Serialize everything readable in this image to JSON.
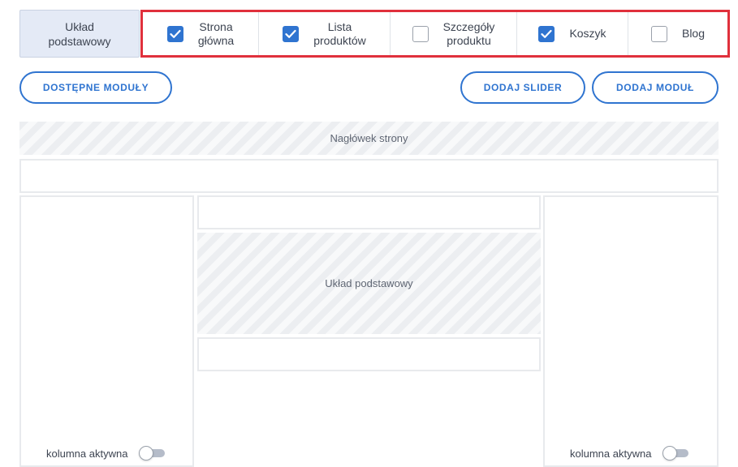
{
  "tabs": {
    "base": {
      "line1": "Układ",
      "line2": "podstawowy"
    },
    "items": [
      {
        "line1": "Strona",
        "line2": "główna",
        "checked": true
      },
      {
        "line1": "Lista",
        "line2": "produktów",
        "checked": true
      },
      {
        "line1": "Szczegóły",
        "line2": "produktu",
        "checked": false
      },
      {
        "line1": "Koszyk",
        "line2": "",
        "checked": true
      },
      {
        "line1": "Blog",
        "line2": "",
        "checked": false
      }
    ]
  },
  "toolbar": {
    "available_modules": "DOSTĘPNE MODUŁY",
    "add_slider": "DODAJ SLIDER",
    "add_module": "DODAJ MODUŁ"
  },
  "layout": {
    "header_label": "Nagłówek strony",
    "center_label": "Układ podstawowy",
    "left_column": {
      "label": "kolumna aktywna",
      "toggle_on": false
    },
    "right_column": {
      "label": "kolumna aktywna",
      "toggle_on": false
    }
  },
  "icons": {
    "checkbox": "check-icon"
  },
  "colors": {
    "accent": "#2f74d0",
    "highlight": "#e0303c",
    "tab_active_bg": "#e4eaf6"
  }
}
